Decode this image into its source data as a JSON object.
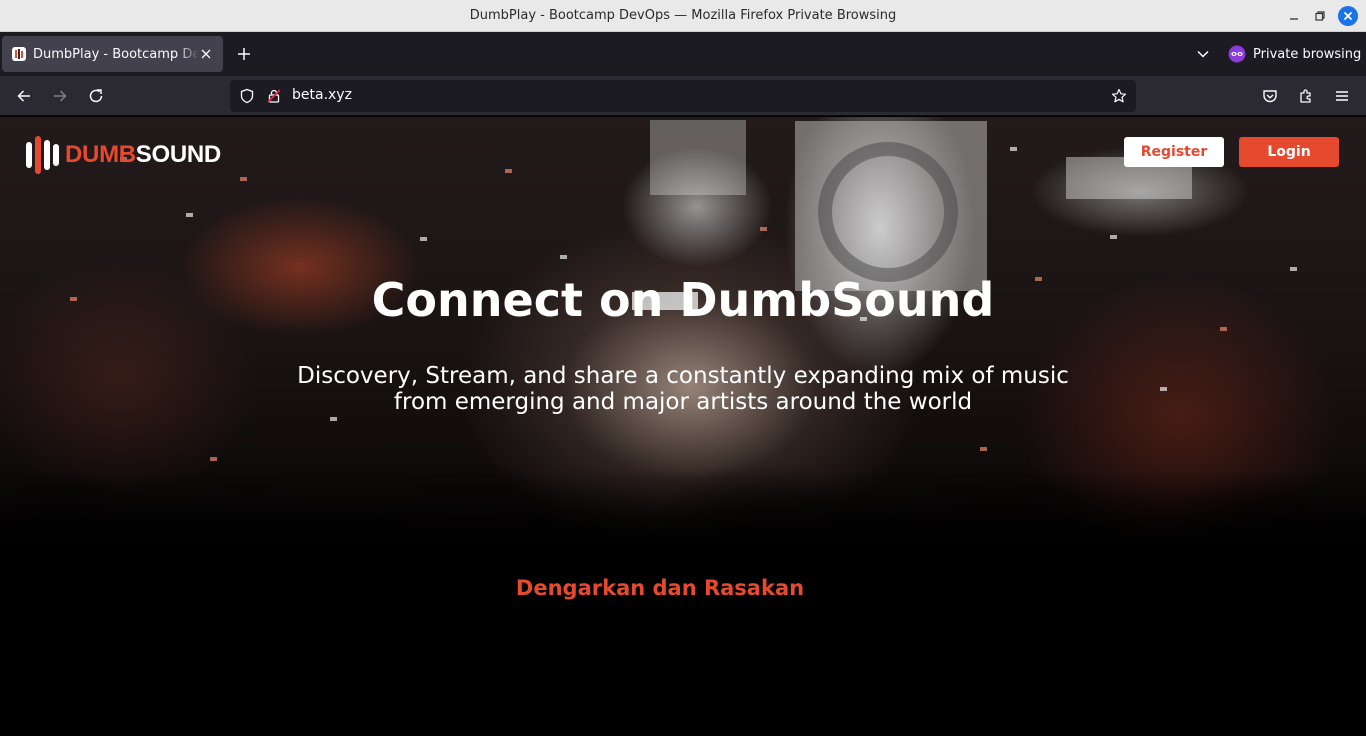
{
  "window": {
    "title": "DumbPlay - Bootcamp DevOps — Mozilla Firefox Private Browsing"
  },
  "browser": {
    "tab_title": "DumbPlay - Bootcamp DevOps",
    "private_label": "Private browsing",
    "url": "beta.xyz"
  },
  "colors": {
    "brand_accent": "#e64a2e",
    "page_background": "#000000",
    "browser_chrome": "#1c1b22",
    "toolbar": "#2b2a33"
  },
  "icons": {
    "tab_favicon": "dumbsound-logo-icon",
    "tab_close": "close-icon",
    "new_tab": "plus-icon",
    "list_tabs": "chevron-down-icon",
    "private": "private-mask-icon",
    "back": "back-arrow-icon",
    "forward": "forward-arrow-icon",
    "reload": "reload-icon",
    "shield": "shield-icon",
    "lock": "lock-icon",
    "bookmark": "star-icon",
    "pocket": "pocket-icon",
    "extensions": "puzzle-icon",
    "menu": "hamburger-menu-icon"
  },
  "header": {
    "logo_part1": "DUMB",
    "logo_part2": "SOUND",
    "register_label": "Register",
    "login_label": "Login"
  },
  "hero": {
    "title": "Connect on DumbSound",
    "subtitle": "Discovery, Stream, and share a constantly expanding mix of music from emerging and major artists around the world"
  },
  "section": {
    "title": "Dengarkan dan Rasakan"
  }
}
